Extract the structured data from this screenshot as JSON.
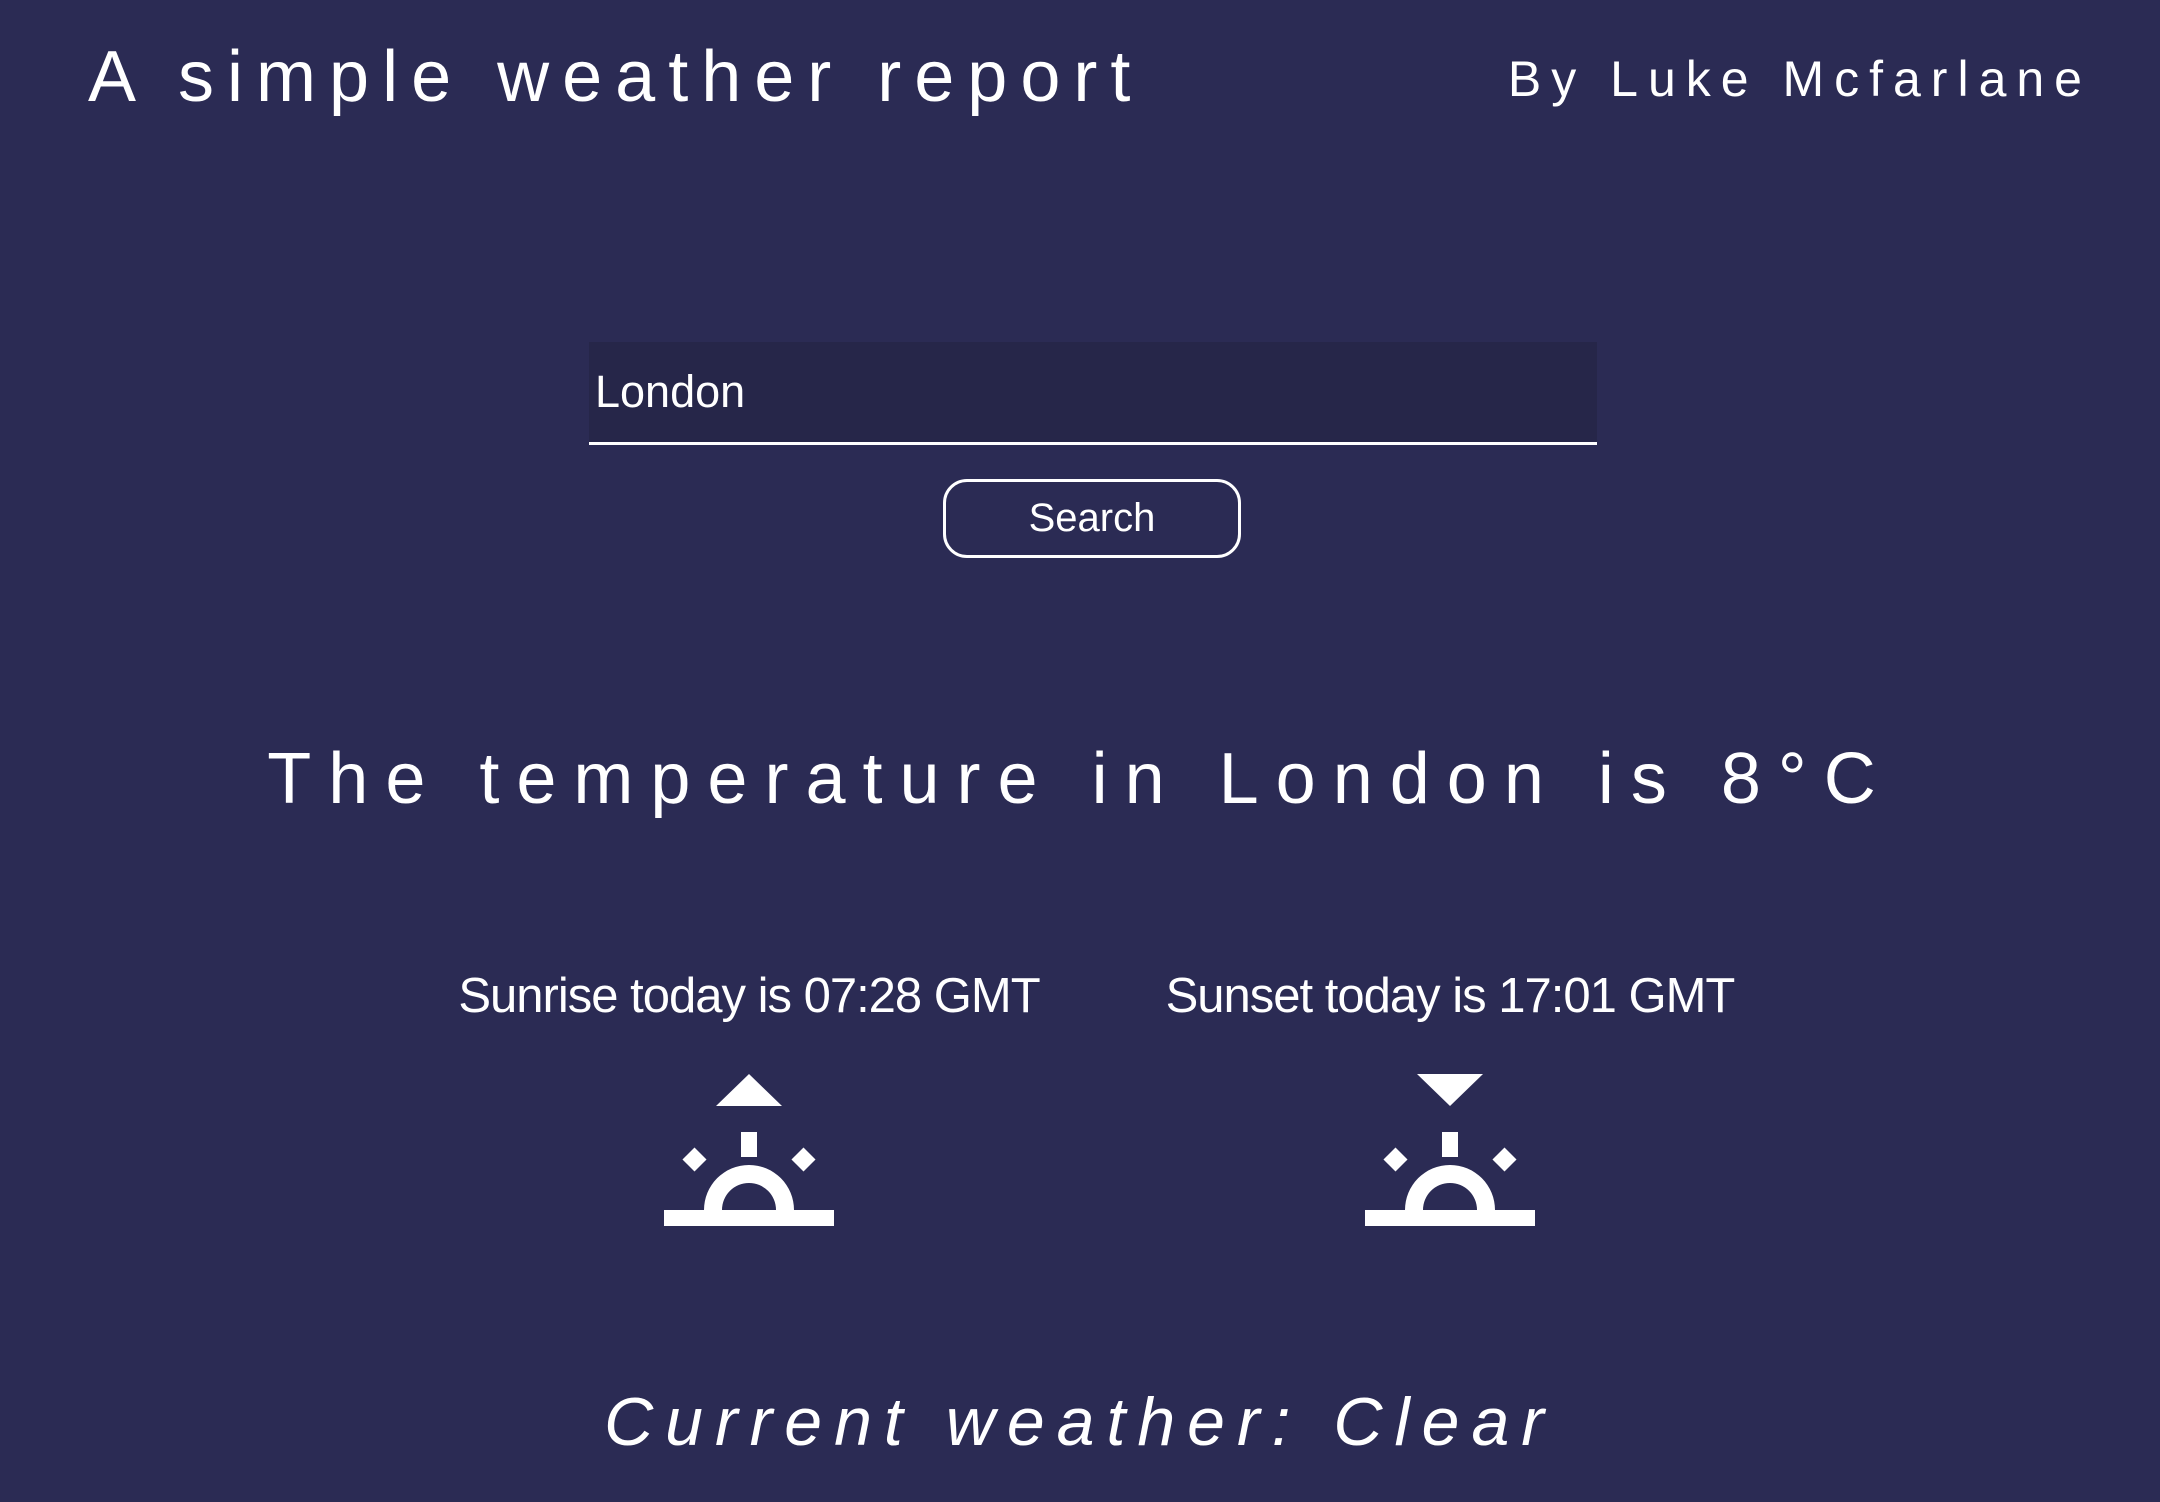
{
  "header": {
    "title": "A simple weather report",
    "author": "By Luke Mcfarlane"
  },
  "search": {
    "value": "London",
    "button_label": "Search"
  },
  "temperature": {
    "text": "The temperature in London is 8°C"
  },
  "sunrise": {
    "label": "Sunrise today is 07:28 GMT",
    "icon": "sunrise-icon"
  },
  "sunset": {
    "label": "Sunset today is 17:01 GMT",
    "icon": "sunset-icon"
  },
  "weather": {
    "text": "Current weather: Clear"
  },
  "colors": {
    "background": "#2b2b54",
    "input_background": "#262649",
    "foreground": "#ffffff"
  }
}
